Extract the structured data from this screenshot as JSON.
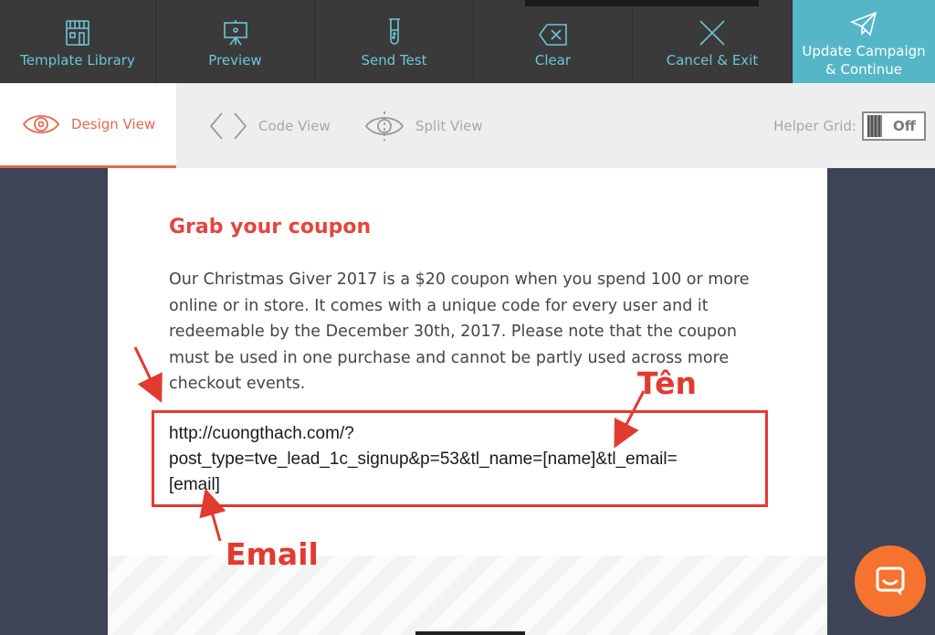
{
  "toolbar": {
    "template_library": {
      "label": "Template Library",
      "icon": "storefront-icon"
    },
    "preview": {
      "label": "Preview",
      "icon": "presentation-board-icon"
    },
    "send_test": {
      "label": "Send Test",
      "icon": "test-tube-icon"
    },
    "clear": {
      "label": "Clear",
      "icon": "backspace-icon"
    },
    "cancel_exit": {
      "label": "Cancel & Exit",
      "icon": "close-icon"
    },
    "update": {
      "label": "Update Campaign\n& Continue",
      "icon": "paper-plane-icon"
    },
    "accent_color": "#6cc5d8",
    "update_bg": "#55b6c8"
  },
  "views": {
    "design": {
      "label": "Design View",
      "icon": "eye-icon",
      "active": true
    },
    "code": {
      "label": "Code View",
      "icon": "code-brackets-icon"
    },
    "split": {
      "label": "Split View",
      "icon": "split-eye-icon"
    },
    "active_color": "#e4684f"
  },
  "helper_grid": {
    "label": "Helper Grid:",
    "state": "Off"
  },
  "email": {
    "heading": "Grab your coupon",
    "body": "Our Christmas Giver 2017 is a $20 coupon when you spend 100 or more online or in store. It comes with a unique code for every user and it redeemable by the December 30th, 2017. Please note that the coupon must be used in one purchase and cannot be partly used across more checkout events.",
    "link_lines": [
      "http://cuongthach.com/?",
      "post_type=tve_lead_1c_signup&p=53&tl_name=[name]&tl_email=",
      "[email]"
    ],
    "heading_color": "#e4463d"
  },
  "annotations": {
    "name_label": "Tên",
    "email_label": "Email",
    "color": "#e33a30"
  },
  "chat": {
    "icon": "chat-bubble-icon",
    "color": "#f5732f"
  }
}
